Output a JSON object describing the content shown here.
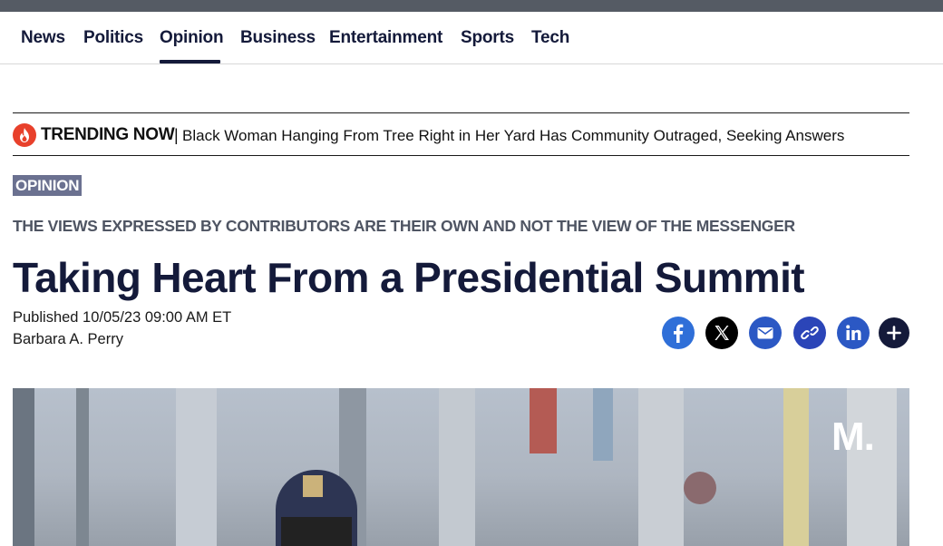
{
  "nav": {
    "items": [
      {
        "label": "News"
      },
      {
        "label": "Politics"
      },
      {
        "label": "Opinion",
        "active": true
      },
      {
        "label": "Business"
      },
      {
        "label": "Entertainment"
      },
      {
        "label": "Sports"
      },
      {
        "label": "Tech"
      }
    ]
  },
  "trending": {
    "label": "TRENDING NOW",
    "separator": "|",
    "headline": "Black Woman Hanging From Tree Right in Her Yard Has Community Outraged, Seeking Answers",
    "icon": "flame-icon"
  },
  "article": {
    "section_badge": "OPINION",
    "disclaimer": "THE VIEWS EXPRESSED BY CONTRIBUTORS ARE THEIR OWN AND NOT THE VIEW OF THE MESSENGER",
    "title": "Taking Heart From a Presidential Summit",
    "published": "Published 10/05/23 09:00 AM ET",
    "author": "Barbara A. Perry"
  },
  "share": {
    "icons": [
      "facebook-icon",
      "x-icon",
      "email-icon",
      "link-icon",
      "linkedin-icon",
      "plus-icon"
    ]
  },
  "hero": {
    "watermark": "M."
  },
  "colors": {
    "brand_navy": "#141a3a",
    "trending_red": "#e8402b",
    "badge_bg": "#6b7190",
    "facebook_blue": "#2f6fd8"
  }
}
